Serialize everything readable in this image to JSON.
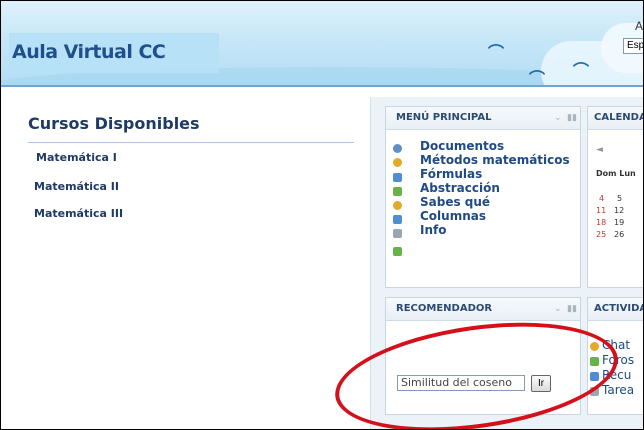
{
  "header": {
    "site_title": "Aula Virtual CC",
    "lang_letter": "A",
    "lang_value": "Esp"
  },
  "left": {
    "title": "Cursos Disponibles",
    "courses": [
      "Matemática I",
      "Matemática II",
      "Matemática III"
    ]
  },
  "main_menu": {
    "title": "MENÚ PRINCIPAL",
    "items": [
      "Documentos",
      "Métodos matemáticos",
      "Fórmulas",
      "Abstracción",
      "Sabes qué",
      "Columnas",
      "Info"
    ]
  },
  "calendar": {
    "title": "CALENDA",
    "prev": "◄",
    "day_headers": "Dom Lun",
    "weeks": [
      [
        "4",
        "5"
      ],
      [
        "11",
        "12"
      ],
      [
        "18",
        "19"
      ],
      [
        "25",
        "26"
      ]
    ]
  },
  "recommender": {
    "title": "RECOMENDADOR",
    "input_value": "Similitud del coseno",
    "button_label": "Ir"
  },
  "activities": {
    "title": "ACTIVIDA",
    "items": [
      "Chat",
      "Foros",
      "Recu",
      "Tarea"
    ]
  },
  "colors": {
    "accent": "#1f4a86",
    "highlight": "#d4101a"
  }
}
